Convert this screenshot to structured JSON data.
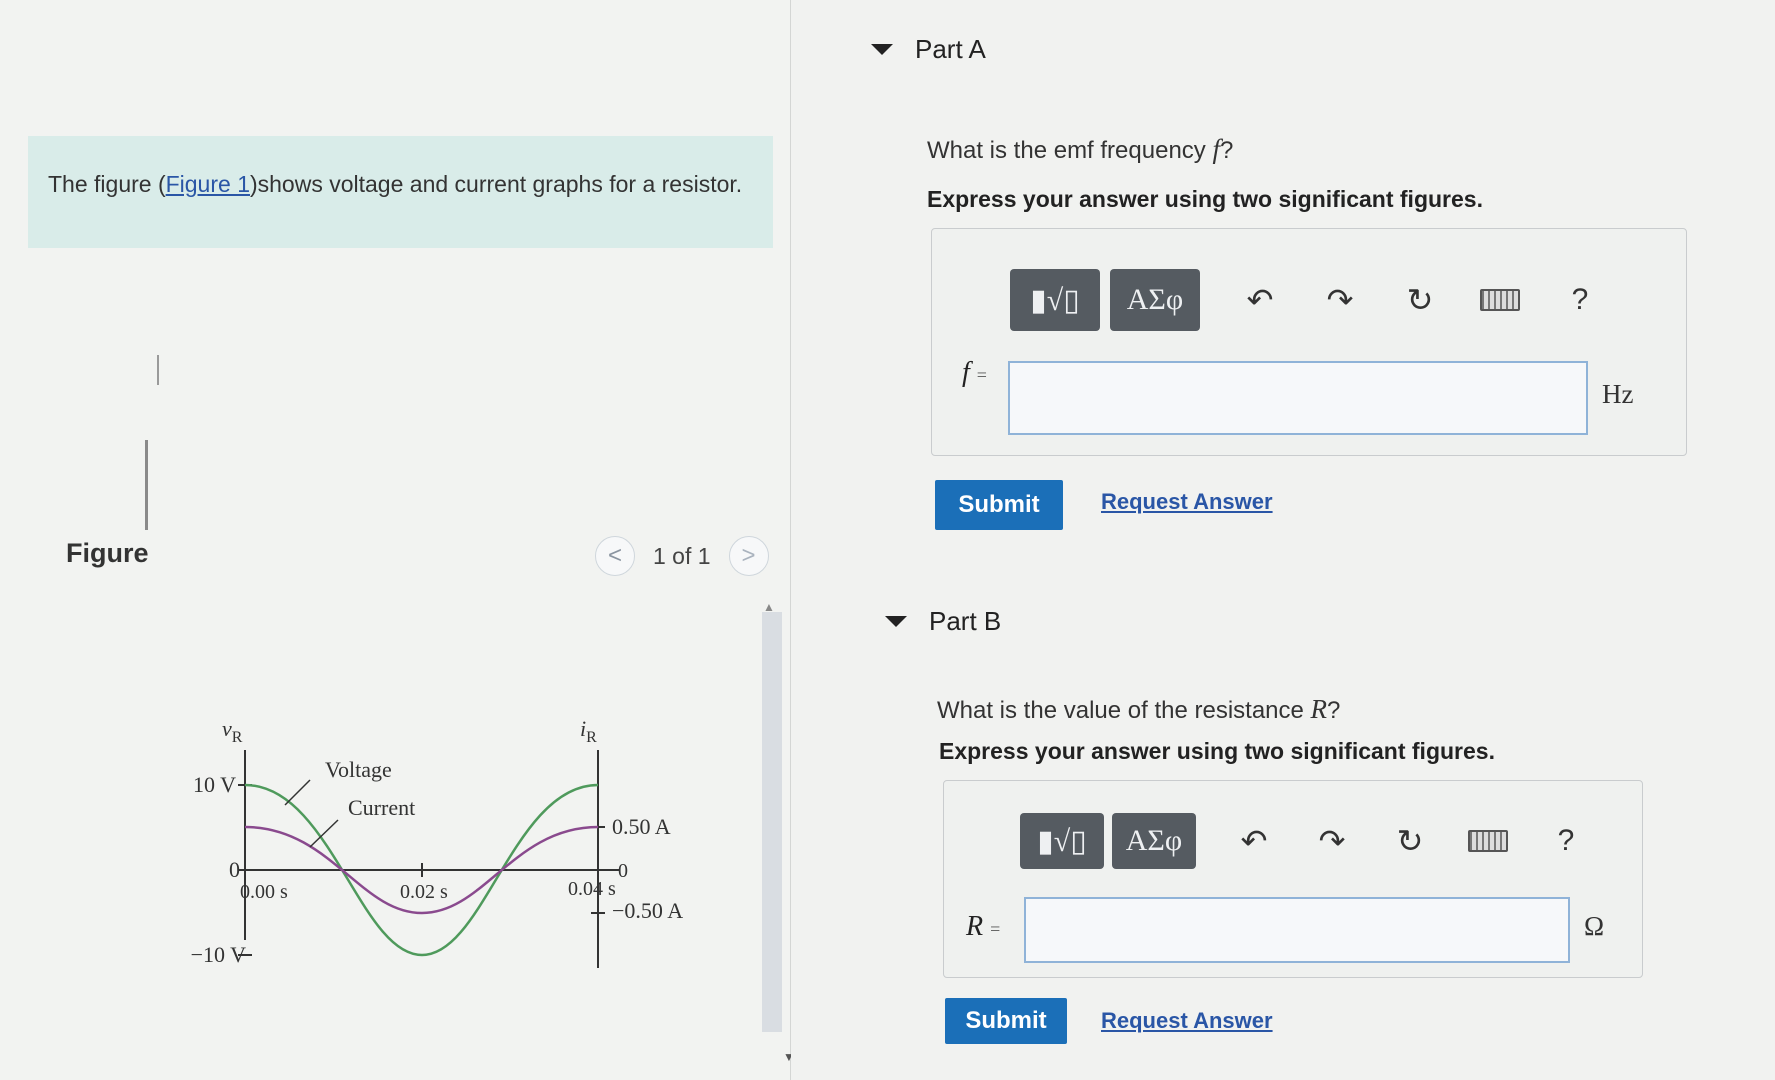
{
  "left": {
    "intro": {
      "text_before": "The figure (",
      "link": "Figure 1",
      "text_after": ")shows voltage and current graphs for a resistor."
    },
    "figure_title": "Figure",
    "pager": {
      "prev": "<",
      "label": "1 of 1",
      "next": ">"
    }
  },
  "graph": {
    "v_axis_label": "v",
    "v_axis_sub": "R",
    "i_axis_label": "i",
    "i_axis_sub": "R",
    "v_top": "10 V",
    "v_zero": "0",
    "v_bottom": "−10 V",
    "i_top": "0.50 A",
    "i_zero": "0",
    "i_bottom": "−0.50 A",
    "t0": "0.00 s",
    "t1": "0.02 s",
    "t2": "0.04 s",
    "voltage_label": "Voltage",
    "current_label": "Current",
    "colors": {
      "voltage": "#4f9a5c",
      "current": "#8a4a8e",
      "axis": "#333333"
    }
  },
  "partA": {
    "title": "Part A",
    "question_prefix": "What is the emf frequency ",
    "question_var": "f",
    "question_suffix": "?",
    "instruction": "Express your answer using two significant figures.",
    "toolbar": {
      "math_btn": "▮√▯",
      "greek_btn": "ΑΣφ",
      "help": "?"
    },
    "var": "f",
    "eq": "=",
    "unit": "Hz",
    "submit": "Submit",
    "request": "Request Answer"
  },
  "partB": {
    "title": "Part B",
    "question_prefix": "What is the value of the resistance ",
    "question_var": "R",
    "question_suffix": "?",
    "instruction": "Express your answer using two significant figures.",
    "toolbar": {
      "math_btn": "▮√▯",
      "greek_btn": "ΑΣφ",
      "help": "?"
    },
    "var": "R",
    "eq": "=",
    "unit": "Ω",
    "submit": "Submit",
    "request": "Request Answer"
  }
}
